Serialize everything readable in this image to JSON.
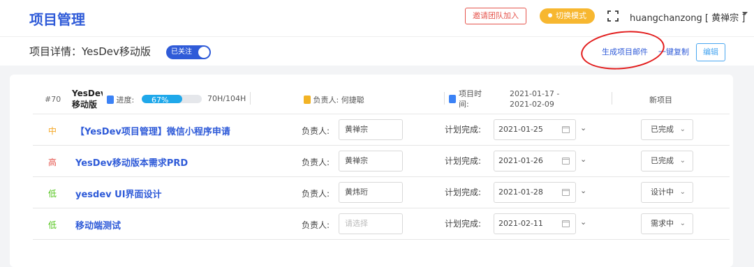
{
  "header": {
    "app_title": "项目管理",
    "invite_label": "邀请团队加入",
    "mode_label": "切换模式",
    "user_label": "huangchanzong [ 黄禅宗 ]"
  },
  "subheader": {
    "detail_title": "项目详情：YesDev移动版",
    "follow_label": "已关注",
    "gen_email_label": "生成项目邮件",
    "copy_label": "一键复制",
    "edit_label": "编辑"
  },
  "project": {
    "number": "#70",
    "name": "YesDev移动版",
    "progress_label": "进度:",
    "progress_percent": 67,
    "progress_text": "67%",
    "hours": "70H/104H",
    "owner_label": "负责人: 何捷聪",
    "time_label": "项目时间:",
    "time_start": "2021-01-17 -",
    "time_end": "2021-02-09",
    "status": "新项目"
  },
  "task_labels": {
    "assignee": "负责人:",
    "plan": "计划完成:"
  },
  "tasks": [
    {
      "priority": "中",
      "priority_color": "#f5a623",
      "name": "【YesDev项目管理】微信小程序申请",
      "assignee": "黄禅宗",
      "date": "2021-01-25",
      "status": "已完成"
    },
    {
      "priority": "高",
      "priority_color": "#e5534b",
      "name": "YesDev移动版本需求PRD",
      "assignee": "黄禅宗",
      "date": "2021-01-26",
      "status": "已完成"
    },
    {
      "priority": "低",
      "priority_color": "#52c41a",
      "name": "yesdev UI界面设计",
      "assignee": "黄炜珩",
      "date": "2021-01-28",
      "status": "设计中"
    },
    {
      "priority": "低",
      "priority_color": "#52c41a",
      "name": "移动端测试",
      "assignee_placeholder": "请选择",
      "date": "2021-02-11",
      "status": "需求中"
    }
  ],
  "icons": {
    "fullscreen": "fullscreen-icon",
    "calendar": "calendar-icon",
    "progress": "document-icon",
    "owner": "document-icon",
    "time": "document-icon"
  }
}
